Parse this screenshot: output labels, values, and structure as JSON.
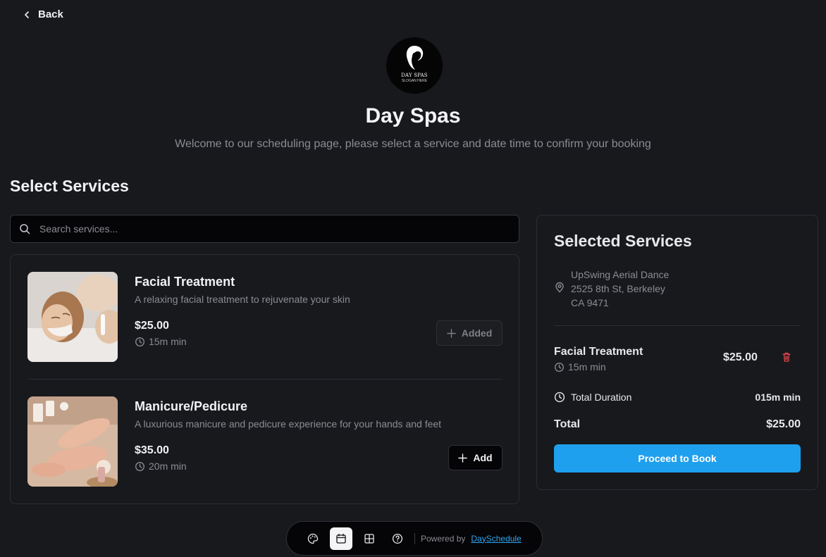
{
  "nav": {
    "back_label": "Back"
  },
  "business": {
    "logo_text": "DAY SPAS",
    "logo_slogan": "SLOGAN HERE",
    "name": "Day Spas",
    "welcome": "Welcome to our scheduling page, please select a service and date time to confirm your booking"
  },
  "services_section": {
    "title": "Select Services",
    "search_placeholder": "Search services...",
    "items": [
      {
        "name": "Facial Treatment",
        "description": "A relaxing facial treatment to rejuvenate your skin",
        "price": "$25.00",
        "duration": "15m min",
        "button_label": "Added",
        "button_icon": "plus-icon",
        "state": "added"
      },
      {
        "name": "Manicure/Pedicure",
        "description": "A luxurious manicure and pedicure experience for your hands and feet",
        "price": "$35.00",
        "duration": "20m min",
        "button_label": "Add",
        "button_icon": "plus-icon",
        "state": "not-added"
      }
    ]
  },
  "selected_panel": {
    "title": "Selected Services",
    "location": [
      "UpSwing Aerial Dance",
      "2525 8th St, Berkeley",
      "CA 9471"
    ],
    "items": [
      {
        "name": "Facial Treatment",
        "duration": "15m min",
        "price": "$25.00"
      }
    ],
    "total_duration_label": "Total Duration",
    "total_duration_value": "015m min",
    "total_label": "Total",
    "total_value": "$25.00",
    "proceed_label": "Proceed to Book"
  },
  "dock": {
    "buttons": [
      "palette-icon",
      "calendar-icon",
      "grid-icon",
      "help-icon"
    ],
    "active": "calendar-icon",
    "powered_by": "Powered by",
    "powered_link": "DaySchedule"
  },
  "colors": {
    "background": "#18191d",
    "accent": "#1fa0ee",
    "danger": "#e5484d",
    "muted_text": "#8b8c93"
  }
}
